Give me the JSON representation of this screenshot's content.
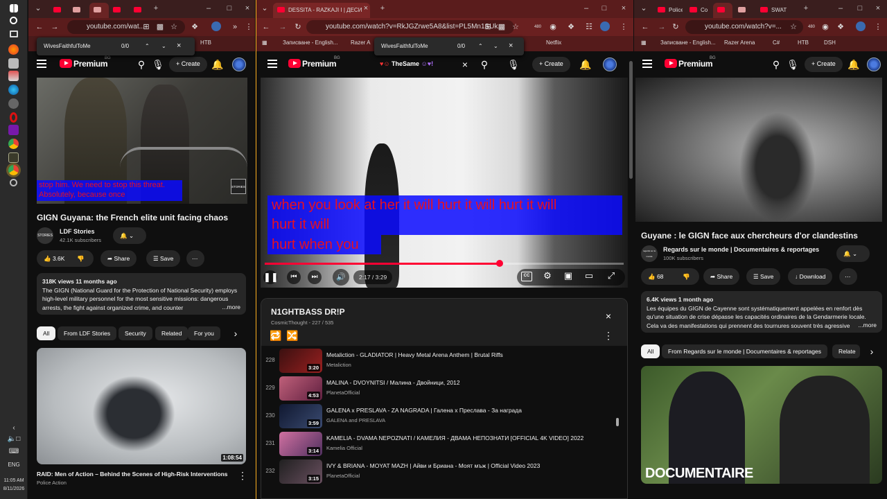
{
  "taskbar": {
    "time": "11:05 AM",
    "date": "8/11/2026",
    "lang": "ENG"
  },
  "left": {
    "tabs": [
      "",
      "",
      "",
      ""
    ],
    "url": "youtube.com/wat...",
    "find": {
      "query": "WivesFaithfulToMe",
      "count": "0/0"
    },
    "bookmarks": [
      "HTB"
    ],
    "yt_word": "Premium",
    "yt_sup": "BG",
    "create": "Create",
    "caption": "stop him.  We need to stop this threat.  Absolutely, because once",
    "watermark": "STORIES",
    "title": "GIGN Guyana: the French elite unit facing chaos",
    "channel": "LDF Stories",
    "channel_av": "STORIES",
    "subs": "42.1K subscribers",
    "likes": "3.6K",
    "share": "Share",
    "save": "Save",
    "desc_meta": "318K views  11 months ago",
    "desc_text": "The GIGN (National Guard for the Protection of National Security) employs high-level military personnel for the most sensitive missions: dangerous arrests, the fight against organized crime, and counter",
    "desc_more": "...more",
    "chips": [
      "All",
      "From LDF Stories",
      "Security",
      "Related",
      "For you"
    ],
    "rec_duration": "1:08:54",
    "rec_title": "RAID: Men of Action – Behind the Scenes of High-Risk Interventions",
    "rec_channel": "Police Action"
  },
  "middle": {
    "tab_title": "DESSITA - RAZKAJI I | ДЕСИ",
    "url": "youtube.com/watch?v=RkJGZrwe5A8&list=PL5Mn1SUk...",
    "ext_badge": "480",
    "find": {
      "query": "WivesFaithfulToMe",
      "count": "0/0"
    },
    "bookmarks": [
      "Записване - English...",
      "Razer A",
      "Netflix"
    ],
    "yt_word": "Premium",
    "yt_sup": "BG",
    "search_text": "TheSame",
    "create": "Create",
    "caption_lines": [
      "when you look at her it will hurt it will hurt it will",
      "hurt it will",
      "hurt when you"
    ],
    "time_display": "2:17 / 3:29",
    "progress": 0.655,
    "playlist": {
      "title": "N1GHTBASS DR!P",
      "meta": "CosmicThought - 227 / 535",
      "items": [
        {
          "idx": "228",
          "title": "Metaliction - GLADIATOR | Heavy Metal Arena Anthem | Brutal Riffs",
          "channel": "Metaliction",
          "duration": "3:20"
        },
        {
          "idx": "229",
          "title": "MALINA - DVOYNITSI / Малина - Двойници, 2012",
          "channel": "PlanetaOfficial",
          "duration": "4:53"
        },
        {
          "idx": "230",
          "title": "GALENA x PRESLAVA - ZA NAGRADA | Галена x Преслава - За награда",
          "channel": "GALENA and PRESLAVA",
          "duration": "3:59"
        },
        {
          "idx": "231",
          "title": "KAMELIA - DVAMA NEPOZNATI / КАМЕЛИЯ - ДВАМА НЕПОЗНАТИ [OFFICIAL 4K VIDEO] 2022",
          "channel": "Kamelia Official",
          "duration": "3:14"
        },
        {
          "idx": "232",
          "title": "IVY & BRIANA - MOYAT MAZH | Айви и Бриана - Моят мъж | Official Video 2023",
          "channel": "PlanetaOfficial",
          "duration": "3:15"
        }
      ]
    }
  },
  "right": {
    "tabs": [
      "Police a",
      "Co",
      "",
      "SWAT"
    ],
    "url": "youtube.com/watch?v=...",
    "ext_badge": "480",
    "bookmarks": [
      "Записване - English...",
      "Razer Arena",
      "C#",
      "HTB",
      "DSH"
    ],
    "yt_word": "Premium",
    "yt_sup": "BG",
    "create": "Create",
    "title": "Guyane : le GIGN face aux chercheurs d'or clandestins",
    "channel": "Regards sur le monde | Documentaires & reportages",
    "channel_av": "regards sur le monde",
    "subs": "100K subscribers",
    "likes": "68",
    "share": "Share",
    "save": "Save",
    "download": "Download",
    "desc_meta": "6.4K views  1 month ago",
    "desc_text": "Les équipes du GIGN de Cayenne sont systématiquement appelées en renfort dès qu'une situation de crise dépasse les capacités ordinaires de la Gendarmerie locale. Cela va des manifestations qui prennent des tournures souvent très agressive",
    "desc_more": "...more",
    "chips": [
      "All",
      "From Regards sur le monde | Documentaires & reportages",
      "Relate"
    ],
    "rec_banner": "DOCUMENTAIRE"
  }
}
